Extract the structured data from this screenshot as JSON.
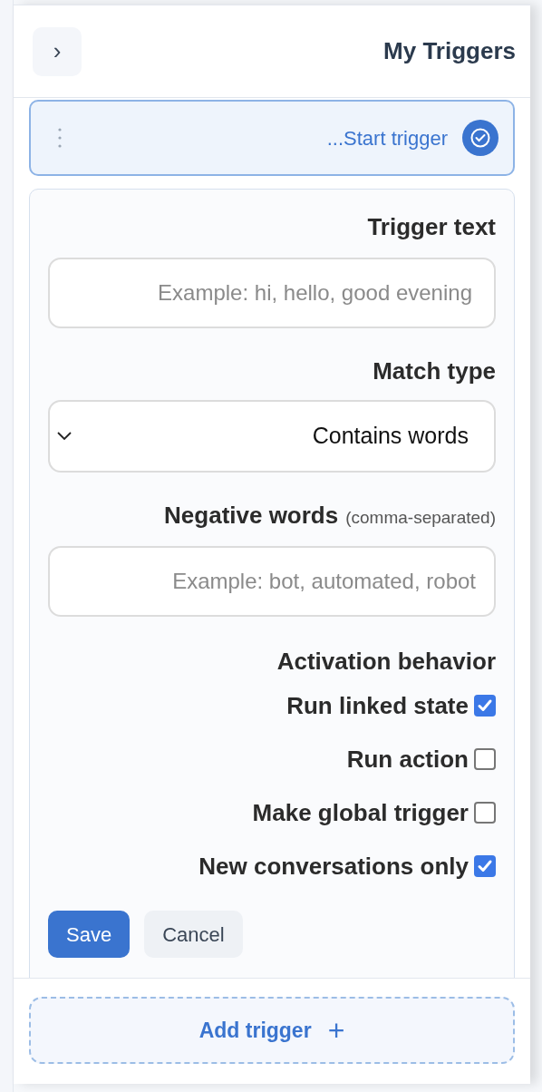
{
  "header": {
    "toggle": "›",
    "title": "My Triggers"
  },
  "trigger_item": {
    "label": "...Start trigger",
    "selected": true
  },
  "form": {
    "trigger_text": {
      "label": "Trigger text",
      "placeholder": "Example: hi, hello, good evening"
    },
    "match_type": {
      "label": "Match type",
      "value": "Contains words"
    },
    "negative_words": {
      "label": "Negative words",
      "hint": "(comma-separated)",
      "placeholder": "Example: bot, automated, robot"
    },
    "activation": {
      "label": "Activation behavior",
      "options": [
        {
          "label": "Run linked state",
          "checked": true
        },
        {
          "label": "Run action",
          "checked": false
        },
        {
          "label": "Make global trigger",
          "checked": false
        },
        {
          "label": "New conversations only",
          "checked": true
        }
      ]
    },
    "buttons": [
      {
        "label": "Save",
        "kind": "primary"
      },
      {
        "label": "Cancel",
        "kind": "secondary"
      }
    ]
  },
  "add_button": {
    "label": "Add trigger",
    "icon": "+"
  }
}
